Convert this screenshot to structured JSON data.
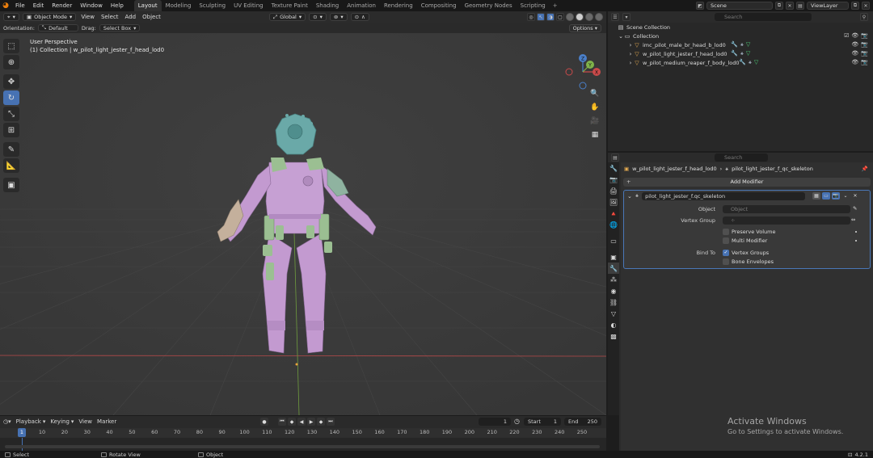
{
  "menu": [
    "File",
    "Edit",
    "Render",
    "Window",
    "Help"
  ],
  "workspaces": [
    "Layout",
    "Modeling",
    "Sculpting",
    "UV Editing",
    "Texture Paint",
    "Shading",
    "Animation",
    "Rendering",
    "Compositing",
    "Geometry Nodes",
    "Scripting"
  ],
  "active_workspace": "Layout",
  "scene_name": "Scene",
  "view_layer": "ViewLayer",
  "viewport": {
    "mode": "Object Mode",
    "menus": [
      "View",
      "Select",
      "Add",
      "Object"
    ],
    "transform_orientation": "Global",
    "orientation_label": "Orientation:",
    "orientation_value": "Default",
    "drag_label": "Drag:",
    "drag_value": "Select Box",
    "options_label": "Options",
    "info_line1": "User Perspective",
    "info_line2": "(1) Collection | w_pilot_light_jester_f_head_lod0",
    "gizmo_labels": {
      "x": "X",
      "y": "Y",
      "z": "Z"
    }
  },
  "outliner": {
    "search_placeholder": "Search",
    "scene_collection": "Scene Collection",
    "collection": "Collection",
    "objects": [
      {
        "name": "imc_pilot_male_br_head_b_lod0"
      },
      {
        "name": "w_pilot_light_jester_f_head_lod0"
      },
      {
        "name": "w_pilot_medium_reaper_f_body_lod0"
      }
    ]
  },
  "properties": {
    "search_placeholder": "Search",
    "breadcrumb_object": "w_pilot_light_jester_f_head_lod0",
    "breadcrumb_modifier": "pilot_light_jester_f_qc_skeleton",
    "add_modifier": "Add Modifier",
    "modifier_name": "pilot_light_jester_f.qc_skeleton",
    "object_label": "Object",
    "object_placeholder": "Object",
    "vertex_group_label": "Vertex Group",
    "preserve_volume": "Preserve Volume",
    "multi_modifier": "Multi Modifier",
    "bind_to_label": "Bind To",
    "vertex_groups": "Vertex Groups",
    "vertex_groups_checked": true,
    "bone_envelopes": "Bone Envelopes"
  },
  "timeline": {
    "menus": [
      "Playback",
      "Keying",
      "View",
      "Marker"
    ],
    "current_frame": "1",
    "start_label": "Start",
    "start": "1",
    "end_label": "End",
    "end": "250",
    "ticks": [
      "1",
      "10",
      "20",
      "30",
      "40",
      "50",
      "60",
      "70",
      "80",
      "90",
      "100",
      "110",
      "120",
      "130",
      "140",
      "150",
      "160",
      "170",
      "180",
      "190",
      "200",
      "210",
      "220",
      "230",
      "240",
      "250"
    ]
  },
  "statusbar": {
    "select": "Select",
    "rotate": "Rotate View",
    "object": "Object",
    "version": "4.2.1"
  },
  "watermark": {
    "line1": "Activate Windows",
    "line2": "Go to Settings to activate Windows."
  },
  "colors": {
    "accent": "#4772b3",
    "x_axis": "#c94a4a",
    "y_axis": "#7fb34a",
    "z_axis": "#4a7fc9",
    "body_purple": "#c39ad0",
    "helmet_teal": "#6aa9a8",
    "armor_green": "#9bbf92"
  }
}
